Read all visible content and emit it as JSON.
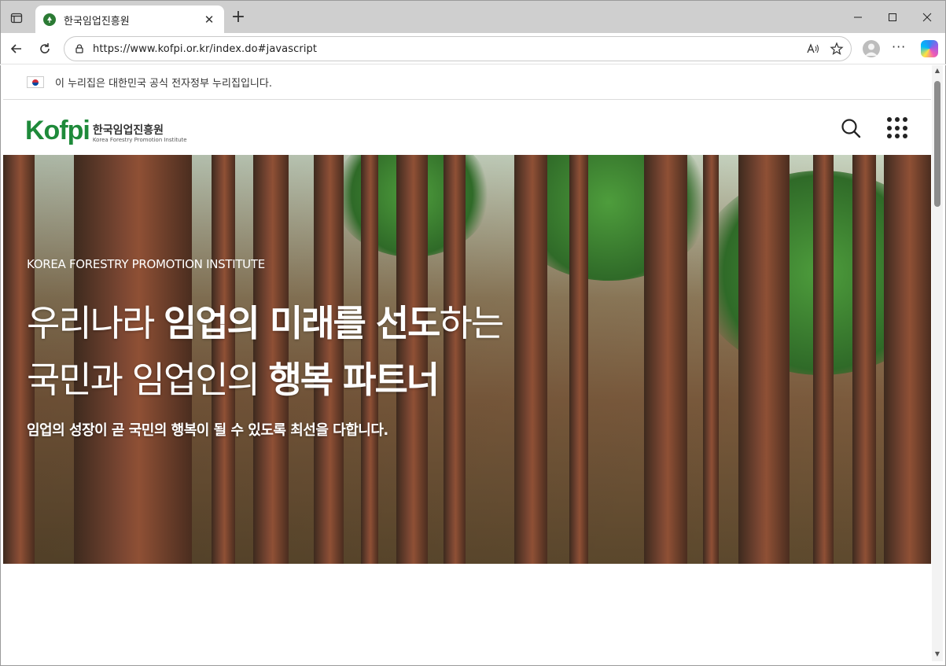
{
  "browser": {
    "tab": {
      "title": "한국임업진흥원"
    },
    "address": {
      "url": "https://www.kofpi.or.kr/index.do#javascript"
    }
  },
  "page": {
    "gov_banner": {
      "text": "이 누리집은 대한민국 공식 전자정부 누리집입니다."
    },
    "logo": {
      "mark": "Kofpi",
      "name_kr": "한국임업진흥원",
      "name_en": "Korea Forestry Promotion Institute"
    },
    "hero": {
      "eyebrow": "KOREA FORESTRY PROMOTION INSTITUTE",
      "line1_a": "우리나라 ",
      "line1_b": "임업의 미래를 선도",
      "line1_c": "하는",
      "line2_a": "국민과 임업인의 ",
      "line2_b": "행복 파트너",
      "description": "임업의 성장이 곧 국민의 행복이 될 수 있도록 최선을 다합니다."
    }
  },
  "colors": {
    "brand_green": "#1e8a3a",
    "tab_strip": "#cfcfcf"
  }
}
